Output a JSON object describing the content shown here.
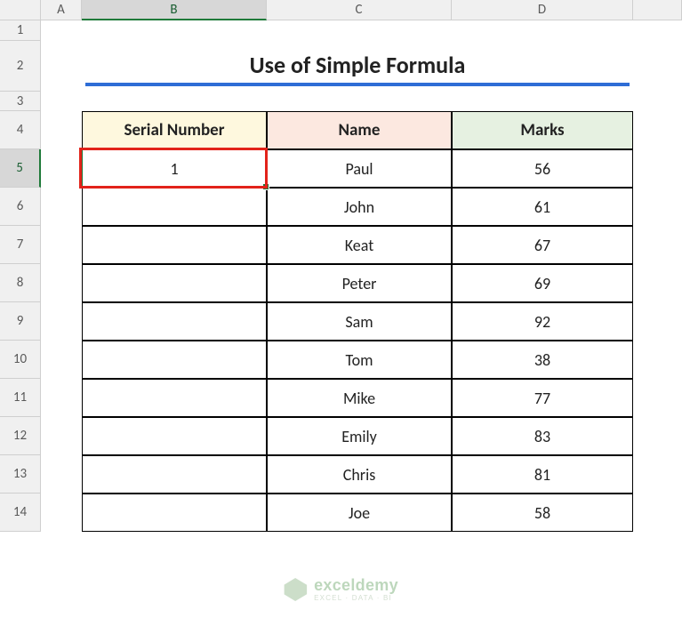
{
  "columns": [
    "A",
    "B",
    "C",
    "D"
  ],
  "rows": [
    "1",
    "2",
    "3",
    "4",
    "5",
    "6",
    "7",
    "8",
    "9",
    "10",
    "11",
    "12",
    "13",
    "14"
  ],
  "selected_row": "5",
  "selected_col": "B",
  "title": "Use of Simple Formula",
  "headers": {
    "serial": "Serial Number",
    "name": "Name",
    "marks": "Marks"
  },
  "active_cell_value": "1",
  "chart_data": {
    "type": "table",
    "columns": [
      "Serial Number",
      "Name",
      "Marks"
    ],
    "rows": [
      {
        "serial": "1",
        "name": "Paul",
        "marks": "56"
      },
      {
        "serial": "",
        "name": "John",
        "marks": "61"
      },
      {
        "serial": "",
        "name": "Keat",
        "marks": "67"
      },
      {
        "serial": "",
        "name": "Peter",
        "marks": "69"
      },
      {
        "serial": "",
        "name": "Sam",
        "marks": "92"
      },
      {
        "serial": "",
        "name": "Tom",
        "marks": "38"
      },
      {
        "serial": "",
        "name": "Mike",
        "marks": "77"
      },
      {
        "serial": "",
        "name": "Emily",
        "marks": "83"
      },
      {
        "serial": "",
        "name": "Chris",
        "marks": "81"
      },
      {
        "serial": "",
        "name": "Joe",
        "marks": "58"
      }
    ]
  },
  "watermark": {
    "title": "exceldemy",
    "sub": "EXCEL · DATA · BI"
  }
}
